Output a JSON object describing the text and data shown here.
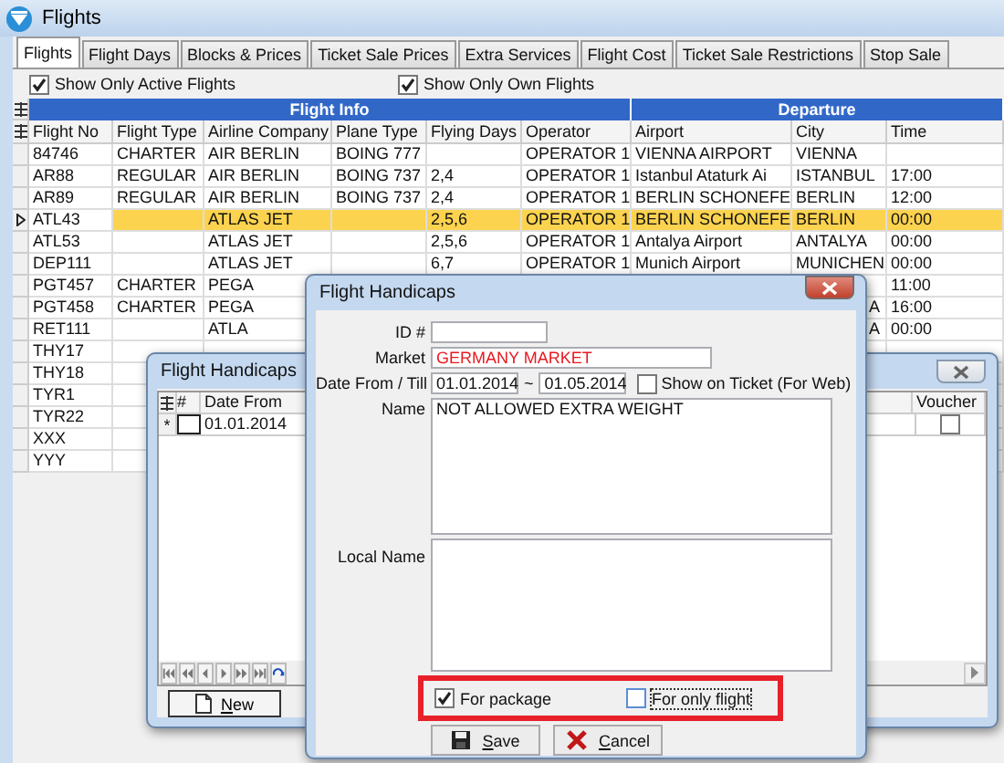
{
  "window": {
    "title": "Flights"
  },
  "tabs": [
    {
      "label": "Flights",
      "selected": true
    },
    {
      "label": "Flight Days",
      "selected": false
    },
    {
      "label": "Blocks & Prices",
      "selected": false
    },
    {
      "label": "Ticket Sale Prices",
      "selected": false
    },
    {
      "label": "Extra Services",
      "selected": false
    },
    {
      "label": "Flight Cost",
      "selected": false
    },
    {
      "label": "Ticket Sale Restrictions",
      "selected": false
    },
    {
      "label": "Stop Sale",
      "selected": false
    }
  ],
  "filters": [
    {
      "label": "Show Only Active Flights",
      "checked": true
    },
    {
      "label": "Show Only Own Flights",
      "checked": true
    }
  ],
  "table": {
    "bands": [
      "Flight Info",
      "Departure"
    ],
    "columns": [
      "Flight No",
      "Flight Type",
      "Airline Company",
      "Plane Type",
      "Flying Days",
      "Operator",
      "Airport",
      "City",
      "Time"
    ],
    "rows": [
      {
        "flight_no": "84746",
        "flight_type": "CHARTER",
        "airline": "AIR BERLIN",
        "plane_type": "BOING 777",
        "operator": "OPERATOR 1",
        "airport": "VIENNA AIRPORT",
        "city": "VIENNA",
        "selected": false
      },
      {
        "flight_no": "AR88",
        "flight_type": "REGULAR",
        "airline": "AIR BERLIN",
        "plane_type": "BOING 737",
        "flying_days": "2,4",
        "operator": "OPERATOR 1",
        "airport": "Istanbul Ataturk Ai",
        "city": "ISTANBUL",
        "time": "17:00",
        "selected": false
      },
      {
        "flight_no": "AR89",
        "flight_type": "REGULAR",
        "airline": "AIR BERLIN",
        "plane_type": "BOING 737",
        "flying_days": "2,4",
        "operator": "OPERATOR 1",
        "airport": "BERLIN SCHONEFE",
        "city": "BERLIN",
        "time": "12:00",
        "selected": false
      },
      {
        "flight_no": "ATL43",
        "airline": "ATLAS JET",
        "flying_days": "2,5,6",
        "operator": "OPERATOR 1",
        "airport": "BERLIN SCHONEFE",
        "city": "BERLIN",
        "time": "00:00",
        "selected": true
      },
      {
        "flight_no": "ATL53",
        "airline": "ATLAS JET",
        "flying_days": "2,5,6",
        "operator": "OPERATOR 1",
        "airport": "Antalya Airport",
        "city": "ANTALYA",
        "time": "00:00",
        "selected": false
      },
      {
        "flight_no": "DEP111",
        "airline": "ATLAS JET",
        "flying_days": "6,7",
        "operator": "OPERATOR 1",
        "airport": "Munich Airport",
        "city": "MUNICHEN",
        "time": "00:00",
        "selected": false
      },
      {
        "flight_no": "PGT457",
        "flight_type": "CHARTER",
        "airline": "PEGA",
        "time": "11:00",
        "selected": false
      },
      {
        "flight_no": "PGT458",
        "flight_type": "CHARTER",
        "airline": "PEGA",
        "city": "A",
        "time": "16:00",
        "selected": false
      },
      {
        "flight_no": "RET111",
        "airline": "ATLA",
        "city": "A",
        "time": "00:00",
        "selected": false
      },
      {
        "flight_no": "THY17",
        "selected": false
      },
      {
        "flight_no": "THY18",
        "selected": false
      },
      {
        "flight_no": "TYR1",
        "selected": false
      },
      {
        "flight_no": "TYR22",
        "selected": false
      },
      {
        "flight_no": "XXX",
        "selected": false
      },
      {
        "flight_no": "YYY",
        "selected": false
      }
    ]
  },
  "handicaps_list": {
    "title": "Flight Handicaps",
    "columns": [
      "#",
      "Date From",
      "Voucher"
    ],
    "rows": [
      {
        "marker": "*",
        "date_from": "01.01.2014",
        "voucher": false
      }
    ],
    "new_button": "New"
  },
  "handicap_form": {
    "title": "Flight Handicaps",
    "id_label": "ID #",
    "market_label": "Market",
    "market_value": "GERMANY MARKET",
    "date_label": "Date From / Till",
    "date_from": "01.01.2014",
    "date_separator": "~",
    "date_till": "01.05.2014",
    "show_on_ticket": {
      "label": "Show on Ticket (For Web)",
      "checked": false
    },
    "name_label": "Name",
    "name_value": "NOT ALLOWED EXTRA WEIGHT",
    "local_name_label": "Local Name",
    "options": [
      {
        "label": "For package",
        "checked": true
      },
      {
        "label": "For only flight",
        "checked": false
      }
    ],
    "buttons": [
      {
        "label": "Save",
        "kind": "save"
      },
      {
        "label": "Cancel",
        "kind": "cancel"
      }
    ]
  }
}
